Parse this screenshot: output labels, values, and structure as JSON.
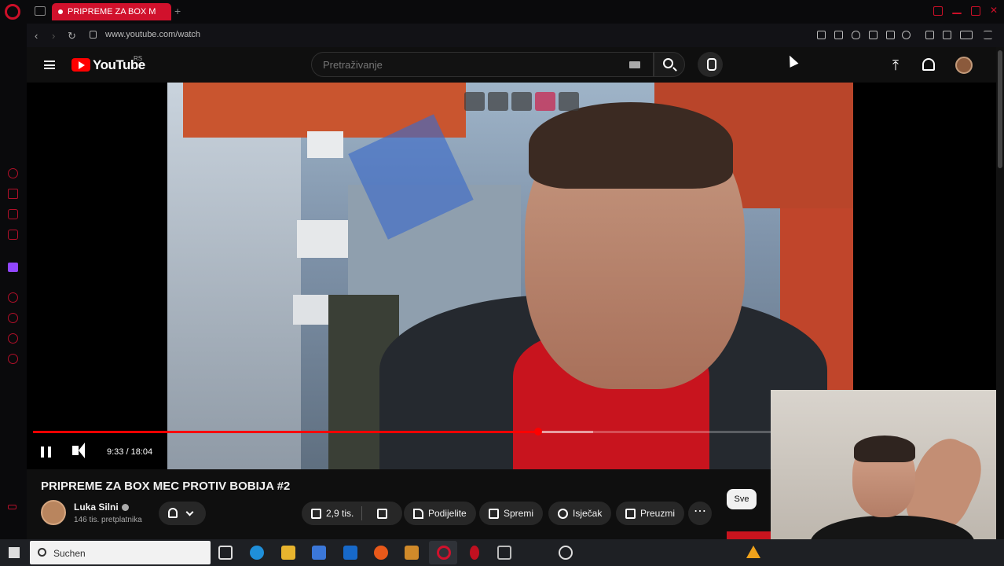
{
  "browser": {
    "tab_title": "PRIPREME ZA BOX M",
    "url": "www.youtube.com/watch",
    "new_tab": "+"
  },
  "youtube": {
    "logo_text": "YouTube",
    "logo_sup": "RS",
    "search_placeholder": "Pretraživanje"
  },
  "player": {
    "time_display": "9:33 / 18:04",
    "progress_played_fraction": 0.528,
    "progress_buffered_fraction": 0.585
  },
  "video": {
    "title": "PRIPREME ZA BOX MEC PROTIV BOBIJA #2",
    "channel_name": "Luka Silni",
    "subscribers": "146 tis. pretplatnika",
    "like_count": "2,9 tis.",
    "actions": [
      "Podijelite",
      "Spremi",
      "Isječak",
      "Preuzmi"
    ],
    "chip_label": "Sve"
  },
  "taskbar": {
    "search_text": "Suchen"
  },
  "colors": {
    "accent": "#ff0000",
    "opera_red": "#d1112c",
    "bg": "#0f0f0f"
  }
}
